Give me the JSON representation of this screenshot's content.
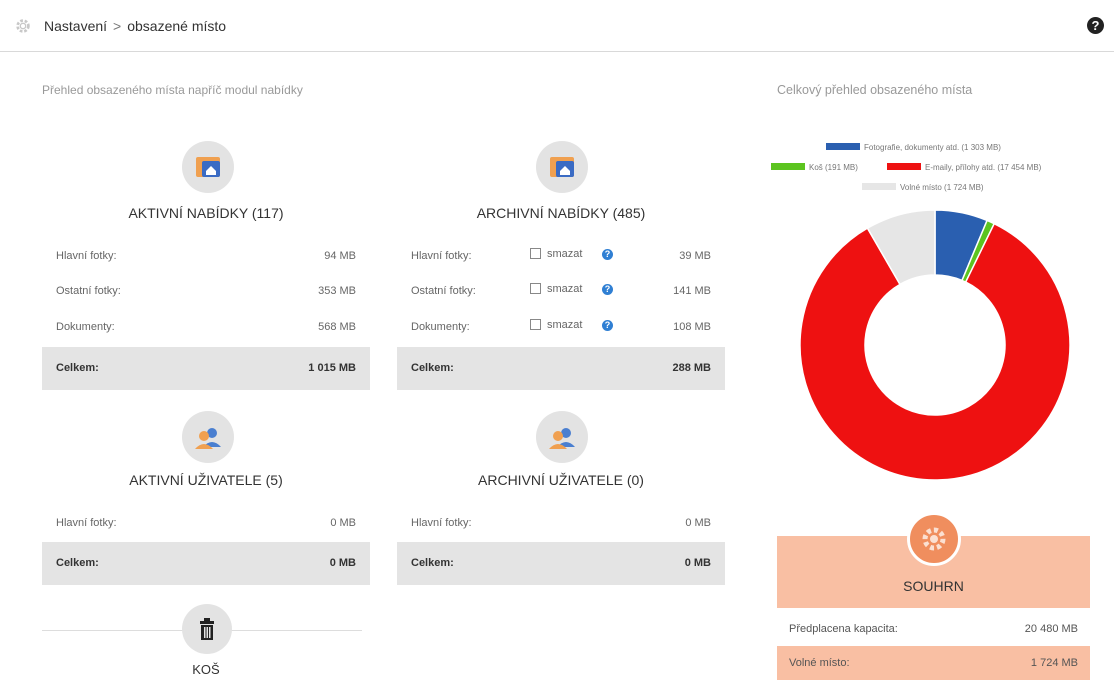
{
  "header": {
    "crumb_root": "Nastavení",
    "crumb_separator": ">",
    "crumb_current": "obsazené místo",
    "help_glyph": "?"
  },
  "left_section_title": "Přehled obsazeného místa napříč modul nabídky",
  "right_section_title": "Celkový přehled obsazeného místa",
  "modules": {
    "active_offers": {
      "title": "AKTIVNÍ NABÍDKY (117)",
      "rows": [
        {
          "label": "Hlavní fotky:",
          "value": "94 MB"
        },
        {
          "label": "Ostatní fotky:",
          "value": "353 MB"
        },
        {
          "label": "Dokumenty:",
          "value": "568 MB"
        }
      ],
      "total_label": "Celkem:",
      "total_value": "1 015 MB"
    },
    "archive_offers": {
      "title": "ARCHIVNÍ NABÍDKY (485)",
      "rows": [
        {
          "label": "Hlavní fotky:",
          "value": "39 MB",
          "check": "smazat"
        },
        {
          "label": "Ostatní fotky:",
          "value": "141 MB",
          "check": "smazat"
        },
        {
          "label": "Dokumenty:",
          "value": "108 MB",
          "check": "smazat"
        }
      ],
      "total_label": "Celkem:",
      "total_value": "288 MB"
    },
    "active_users": {
      "title": "AKTIVNÍ UŽIVATELE (5)",
      "rows": [
        {
          "label": "Hlavní fotky:",
          "value": "0 MB"
        }
      ],
      "total_label": "Celkem:",
      "total_value": "0 MB"
    },
    "archive_users": {
      "title": "ARCHIVNÍ UŽIVATELE (0)",
      "rows": [
        {
          "label": "Hlavní fotky:",
          "value": "0 MB"
        }
      ],
      "total_label": "Celkem:",
      "total_value": "0 MB"
    },
    "trash": {
      "title": "KOŠ"
    }
  },
  "chart_data": {
    "type": "pie",
    "donut": true,
    "series": [
      {
        "name": "Fotografie, dokumenty atd. (1 303 MB)",
        "value": 1303,
        "color": "#2a5fb0"
      },
      {
        "name": "Koš (191 MB)",
        "value": 191,
        "color": "#5cc41f"
      },
      {
        "name": "E-maily, přílohy atd. (17 454 MB)",
        "value": 17454,
        "color": "#ee1111"
      },
      {
        "name": "Volné místo (1 724 MB)",
        "value": 1724,
        "color": "#e6e6e6"
      }
    ],
    "legend_position": "top"
  },
  "summary": {
    "title": "SOUHRN",
    "rows": [
      {
        "label": "Předplacena kapacita:",
        "value": "20 480 MB"
      },
      {
        "label": "Volné místo:",
        "value": "1 724 MB"
      }
    ]
  }
}
